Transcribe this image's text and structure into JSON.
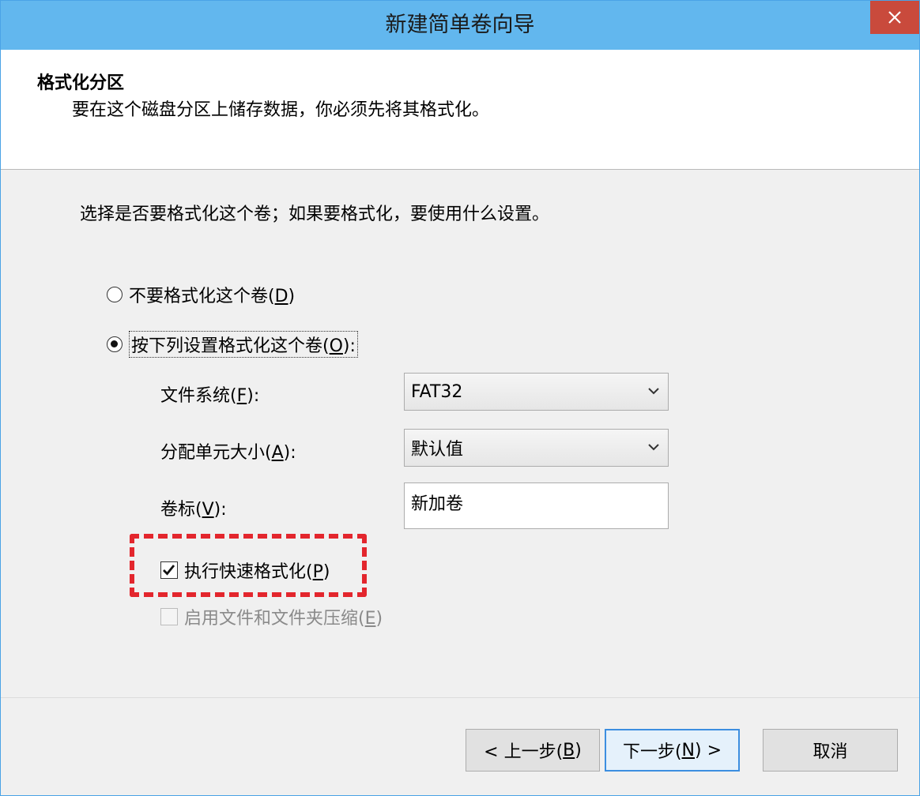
{
  "window": {
    "title": "新建简单卷向导",
    "close_glyph": "✕"
  },
  "header": {
    "title": "格式化分区",
    "subtitle": "要在这个磁盘分区上储存数据，你必须先将其格式化。"
  },
  "instruction": "选择是否要格式化这个卷；如果要格式化，要使用什么设置。",
  "options": {
    "no_format": {
      "label": "不要格式化这个卷(",
      "key": "D",
      "tail": ")",
      "selected": false
    },
    "format": {
      "label": "按下列设置格式化这个卷(",
      "key": "O",
      "tail": "):",
      "selected": true
    }
  },
  "fields": {
    "file_system": {
      "label": "文件系统(",
      "key": "F",
      "tail": "):",
      "value": "FAT32"
    },
    "allocation": {
      "label": "分配单元大小(",
      "key": "A",
      "tail": "):",
      "value": "默认值"
    },
    "volume_label": {
      "label": "卷标(",
      "key": "V",
      "tail": "):",
      "value": "新加卷"
    }
  },
  "checkboxes": {
    "quick_format": {
      "label": "执行快速格式化(",
      "key": "P",
      "tail": ")",
      "checked": true
    },
    "compression": {
      "label": "启用文件和文件夹压缩(",
      "key": "E",
      "tail": ")",
      "checked": false,
      "disabled": true
    }
  },
  "buttons": {
    "back": {
      "prefix": "< 上一步(",
      "key": "B",
      "tail": ")"
    },
    "next": {
      "prefix": "下一步(",
      "key": "N",
      "tail": ") >"
    },
    "cancel": "取消"
  },
  "colors": {
    "titlebar": "#62b7ee",
    "close": "#c94a3c",
    "highlight": "#e3262d"
  }
}
